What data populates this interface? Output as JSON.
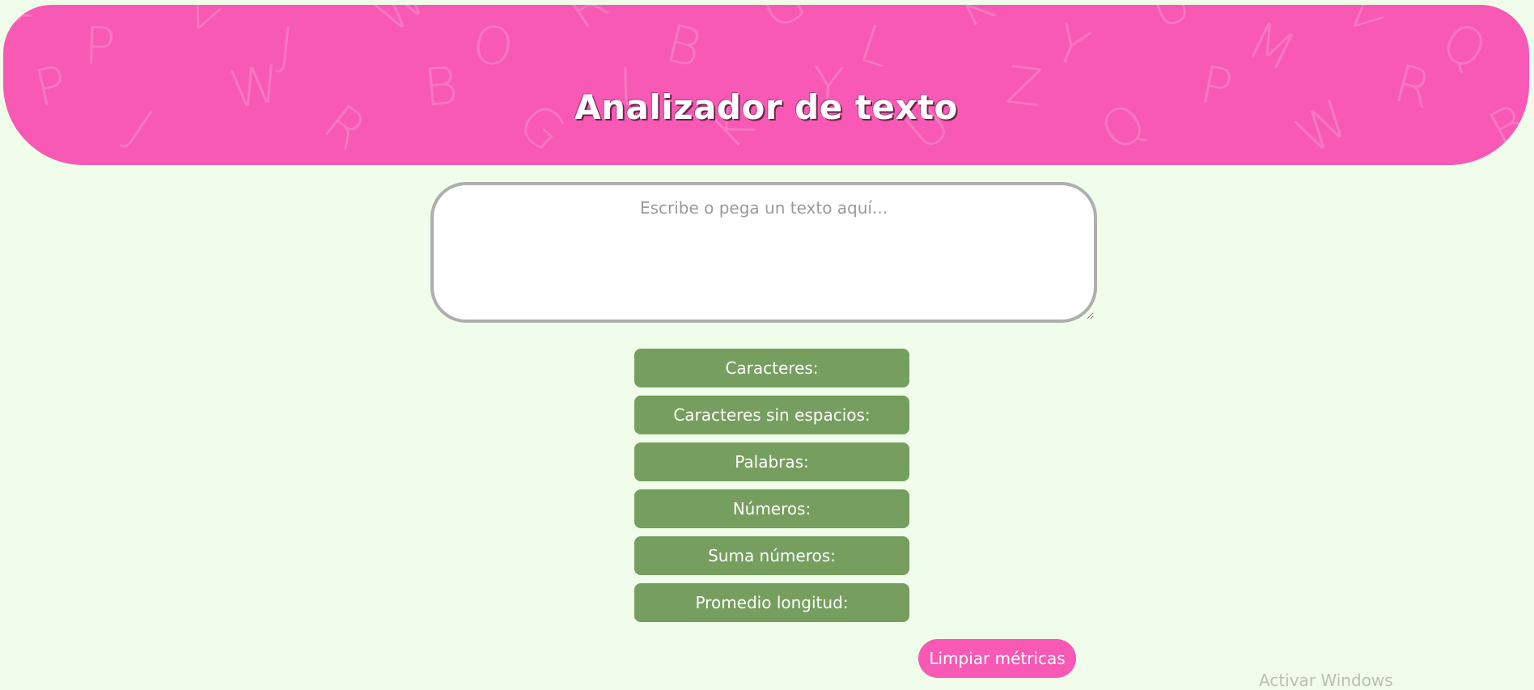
{
  "header": {
    "title": "Analizador de texto",
    "background_color": "#f759b5",
    "pattern_letters": [
      "Q",
      "P",
      "Z",
      "J",
      "W",
      "O",
      "R",
      "B",
      "G",
      "L",
      "K",
      "Y",
      "U",
      "M",
      "Z",
      "Q",
      "P",
      "J",
      "W",
      "R",
      "B",
      "G",
      "L",
      "K",
      "Y",
      "U",
      "Z",
      "Q",
      "P",
      "W",
      "R",
      "B"
    ]
  },
  "input": {
    "placeholder": "Escribe o pega un texto aquí...",
    "value": ""
  },
  "metrics": [
    {
      "label": "Caracteres:"
    },
    {
      "label": "Caracteres sin espacios:"
    },
    {
      "label": "Palabras:"
    },
    {
      "label": "Números:"
    },
    {
      "label": "Suma números:"
    },
    {
      "label": "Promedio longitud:"
    }
  ],
  "actions": {
    "clear_label": "Limpiar métricas"
  },
  "os_overlay": {
    "text": "Activar Windows"
  },
  "colors": {
    "page_bg": "#f0fdea",
    "metric_bg": "#769e5f",
    "accent": "#f759b5"
  }
}
